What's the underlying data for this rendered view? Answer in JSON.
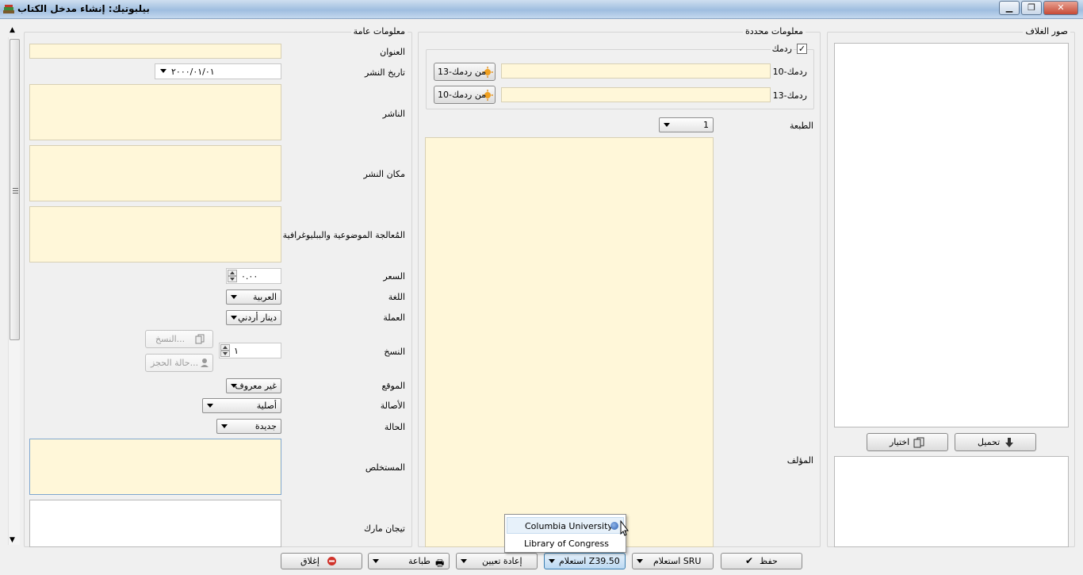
{
  "window": {
    "title": "بيلبوتيك: إنشاء مدخل الكتاب",
    "minimize_label": "▁",
    "restore_label": "❐",
    "close_label": "✕"
  },
  "general": {
    "group_title": "معلومات عامة",
    "title_label": "العنوان",
    "pub_date_label": "تاريخ النشر",
    "pub_date_value": "٢٠٠٠/٠١/٠١",
    "publisher_label": "الناشر",
    "pub_place_label": "مكان النشر",
    "subject_label": "المُعالجة الموضوعية والببليوغرافية",
    "price_label": "السعر",
    "price_value": "٠.٠٠",
    "language_label": "اللغة",
    "language_value": "العربية",
    "currency_label": "العملة",
    "currency_value": "دينار أردني",
    "copies_label": "النسخ",
    "copies_value": "١",
    "copies_button": "النسخ...",
    "reservation_button": "حالة الحجز...",
    "location_label": "الموقع",
    "location_value": "غير معروف",
    "originality_label": "الأصالة",
    "originality_value": "أصلية",
    "condition_label": "الحالة",
    "condition_value": "جديدة",
    "abstract_label": "المستخلص",
    "marc_label": "تيجان مارك"
  },
  "specific": {
    "group_title": "معلومات محددة",
    "isbn_checkbox_label": "ردمك",
    "isbn10_label": "ردمك-10",
    "isbn13_label": "ردمك-13",
    "from_isbn13_button": "من ردمك-13",
    "from_isbn10_button": "من ردمك-10",
    "edition_label": "الطبعة",
    "edition_value": "1",
    "author_label": "المؤلف"
  },
  "cover": {
    "group_title": "صور الغلاف",
    "upload_button": "تحميل",
    "choose_button": "اختيار"
  },
  "bottom": {
    "save": "حفظ",
    "sru": "استعلام SRU",
    "z3950": "استعلام Z39.50",
    "reset": "إعادة تعيين",
    "print": "طباعة",
    "close": "إغلاق"
  },
  "z3950_menu": {
    "items": [
      "Columbia University",
      "Library of Congress"
    ]
  },
  "colors": {
    "field_bg": "#fff7d9",
    "title_bar": "#a8c4e2",
    "highlight": "#e7f1fa"
  }
}
